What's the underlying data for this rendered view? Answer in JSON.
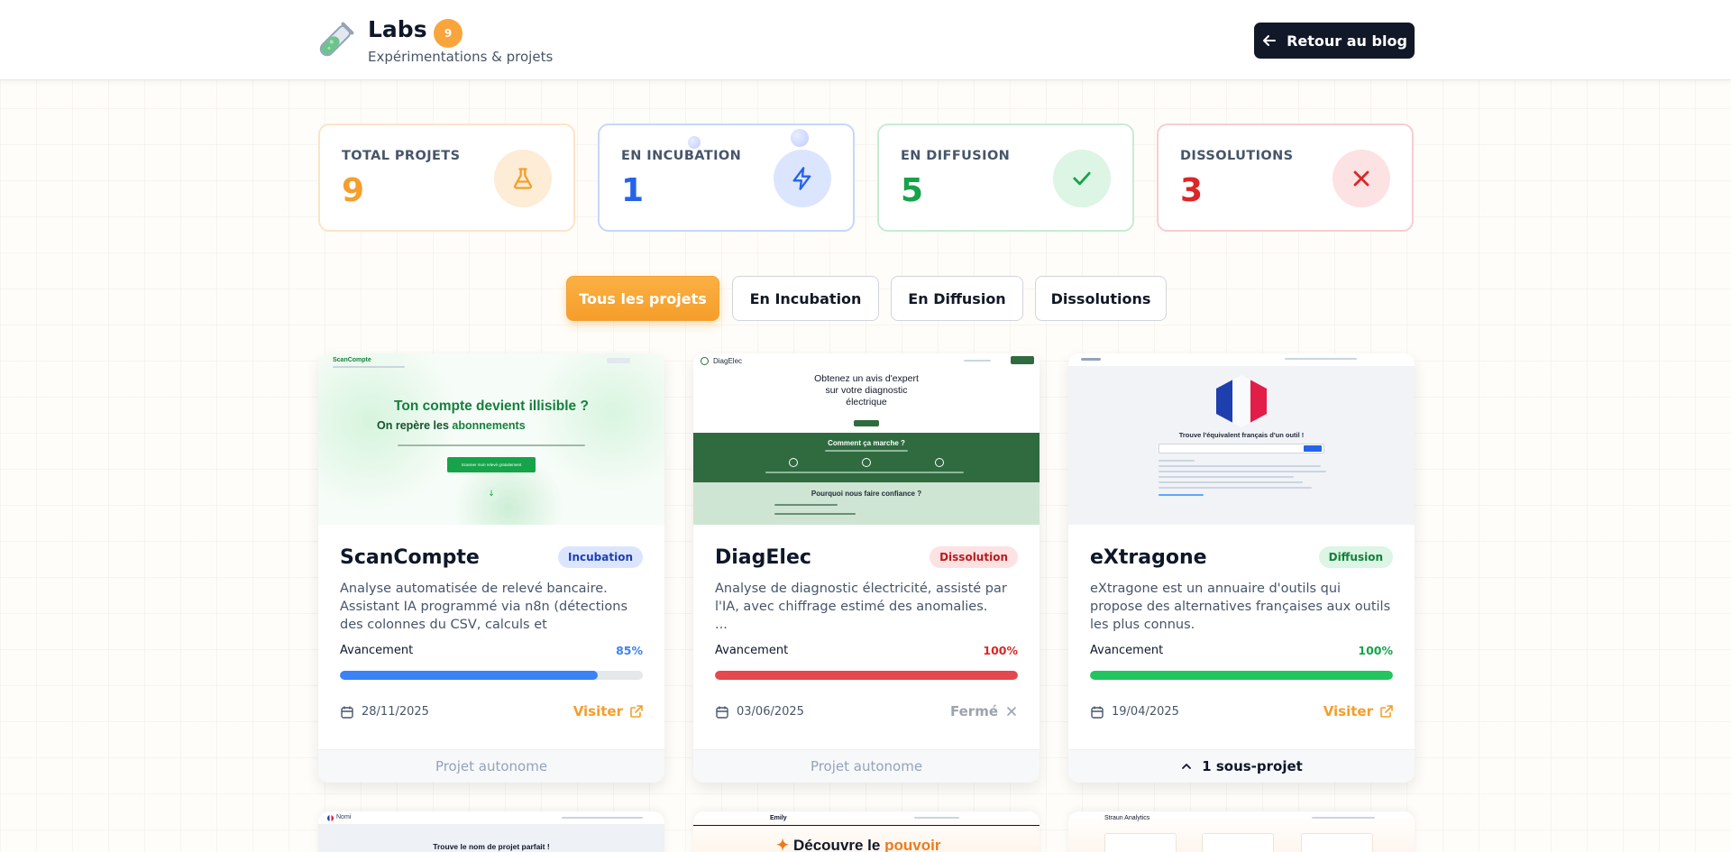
{
  "header": {
    "title": "Labs",
    "badge": "9",
    "subtitle": "Expérimentations & projets",
    "back_label": "Retour au blog"
  },
  "stats": [
    {
      "label": "TOTAL PROJETS",
      "value": "9",
      "color": "#f59e2a",
      "icon": "flask-icon"
    },
    {
      "label": "EN INCUBATION",
      "value": "1",
      "color": "#2563eb",
      "icon": "bolt-icon"
    },
    {
      "label": "EN DIFFUSION",
      "value": "5",
      "color": "#16a34a",
      "icon": "check-icon"
    },
    {
      "label": "DISSOLUTIONS",
      "value": "3",
      "color": "#dc2626",
      "icon": "x-icon"
    }
  ],
  "filters": [
    {
      "label": "Tous les projets",
      "active": true
    },
    {
      "label": "En Incubation",
      "active": false
    },
    {
      "label": "En Diffusion",
      "active": false
    },
    {
      "label": "Dissolutions",
      "active": false
    }
  ],
  "progress_label": "Avancement",
  "cards": [
    {
      "title": "ScanCompte",
      "status": "Incubation",
      "description": "Analyse automatisée de relevé bancaire. Assistant IA programmé via n8n (détections des colonnes du CSV, calculs et catégorisations,…",
      "progress": "85%",
      "progress_value": 85,
      "progress_color": "#3b82f6",
      "date": "28/11/2025",
      "action": "Visiter",
      "footer": "Projet autonome",
      "thumb": {
        "brand": "ScanCompte",
        "headline1": "Ton compte devient illisible ?",
        "headline2": "On repère les",
        "headline2_accent": "abonnements",
        "cta": "Scanner mon relevé gratuitement"
      }
    },
    {
      "title": "DiagElec",
      "status": "Dissolution",
      "description": "Analyse de diagnostic électricité, assisté par l'IA, avec chiffrage estimé des anomalies.\n...",
      "progress": "100%",
      "progress_value": 100,
      "progress_color": "#e5484d",
      "date": "03/06/2025",
      "action": "Fermé",
      "footer": "Projet autonome",
      "thumb": {
        "brand": "DiagElec",
        "headline": "Obtenez un avis d'expert sur votre diagnostic électrique",
        "section1": "Comment ça marche ?",
        "section2": "Pourquoi nous faire confiance ?"
      }
    },
    {
      "title": "eXtragone",
      "status": "Diffusion",
      "description": "eXtragone est un annuaire d'outils qui propose des alternatives françaises aux outils les plus connus.",
      "progress": "100%",
      "progress_value": 100,
      "progress_color": "#22c55e",
      "date": "19/04/2025",
      "action": "Visiter",
      "footer": "1 sous-projet",
      "thumb": {
        "headline": "Trouve l'équivalent français d'un outil !"
      }
    }
  ],
  "bottom_cards": [
    {
      "brand": "Nomi",
      "headline": "Trouve le nom de projet parfait !"
    },
    {
      "brand": "Emily",
      "headline": "Découvre le",
      "headline_accent": "pouvoir"
    },
    {
      "brand": "Straun Analytics"
    }
  ]
}
